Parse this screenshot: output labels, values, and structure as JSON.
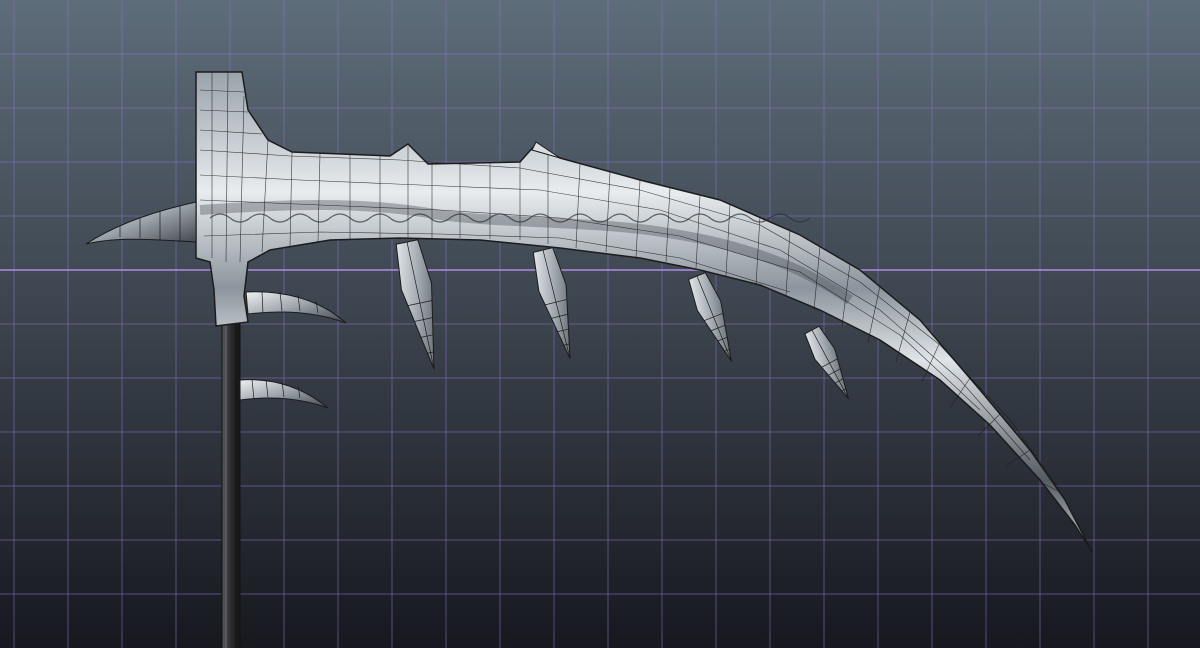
{
  "viewport": {
    "background_top": "#5e6d7a",
    "background_bottom": "#17181f",
    "grid_color": "#8a72c8",
    "grid_center_line_color": "#a78ad8"
  },
  "model": {
    "blade_highlight": "#e8ecef",
    "blade_mid": "#9aa3ab",
    "blade_shadow": "#4a5058",
    "wireframe_color": "#1c1c1c",
    "shaft_color": "#2b2b2e"
  }
}
